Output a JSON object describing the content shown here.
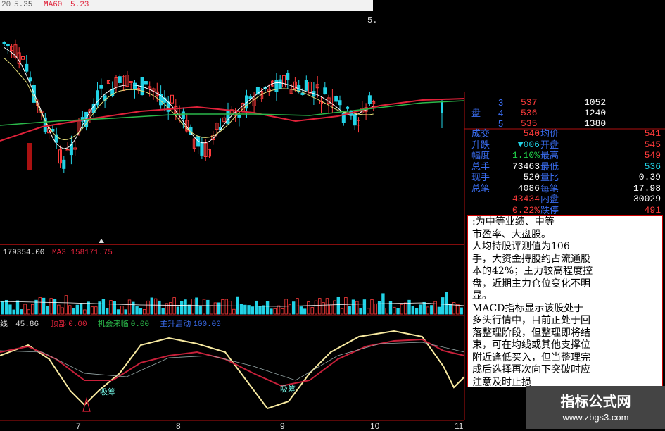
{
  "header": {
    "ma_prefix": "20",
    "ma_value": "5.35",
    "ma60_label": "MA60",
    "ma60_value": "5.23",
    "price_axis_top": "5."
  },
  "order_book": [
    {
      "side_label": "",
      "level": "3",
      "price": "537",
      "volume": "1052"
    },
    {
      "side_label": "盘",
      "level": "4",
      "price": "536",
      "volume": "1240"
    },
    {
      "side_label": "",
      "level": "5",
      "price": "535",
      "volume": "1380"
    }
  ],
  "quote": [
    {
      "label": "成交",
      "value": "540",
      "label2": "均价",
      "value2": "541",
      "color": "#ff3b3b",
      "color2": "#ff3b3b"
    },
    {
      "label": "升跌",
      "value": "▼006",
      "label2": "开盘",
      "value2": "545",
      "color": "#22d3e6",
      "color2": "#ff3b3b"
    },
    {
      "label": "幅度",
      "value": "1.10%",
      "label2": "最高",
      "value2": "549",
      "color": "#21d24a",
      "color2": "#ff3b3b"
    },
    {
      "label": "总手",
      "value": "73463",
      "label2": "最低",
      "value2": "536",
      "color": "#ffffff",
      "color2": "#22d3e6"
    },
    {
      "label": "现手",
      "value": "520",
      "label2": "量比",
      "value2": "0.39",
      "color": "#ffffff",
      "color2": "#ffffff"
    },
    {
      "label": "总笔",
      "value": "4086",
      "label2": "每笔",
      "value2": "17.98",
      "color": "#ffffff",
      "color2": "#ffffff"
    },
    {
      "label": "",
      "value": "43434",
      "label2": "内盘",
      "value2": "30029",
      "color": "#ff3b3b",
      "color2": "#ffffff"
    },
    {
      "label": "",
      "value": "0.22%",
      "label2": "跌停",
      "value2": "491",
      "color": "#ff3b3b",
      "color2": "#ff3b3b"
    }
  ],
  "commentary": [
    ":为中等业绩、中等",
    "市盈率、大盘股。",
    "    人均持股评测值为106",
    "手，大资金持股约占流通股",
    "本的42%；主力较高程度控",
    "盘，近期主力仓位变化不明",
    "显。",
    "    MACD指标显示该股处于",
    "多头行情中，目前正处于回",
    "落整理阶段，但整理即将结",
    "束，可在均线或其他支撑位",
    "附近逢低买入，但当整理完",
    "成后选择再次向下突破时应",
    "注意及时止损"
  ],
  "volume_panel": {
    "volume": "179354.00",
    "ma3_label": "MA3",
    "ma3_value": "158171.75"
  },
  "indicator_panel": {
    "line_label": "线",
    "line_value": "45.86",
    "item2_label": "顶部",
    "item2_value": "0.00",
    "item3_label": "机会来临",
    "item3_value": "0.00",
    "item4_label": "主升启动",
    "item4_value": "100.00",
    "marker_label": "吸筹"
  },
  "x_axis": {
    "ticks": [
      "7",
      "8",
      "9",
      "10",
      "11"
    ]
  },
  "watermark": {
    "title": "指标公式网",
    "url": "www.zbgs3.com"
  },
  "colors": {
    "up": "#ff3b3b",
    "down": "#22d3e6",
    "ma_red": "#e0223a",
    "ma_green": "#2bb84a",
    "osc_yellow": "#f7e9a0",
    "osc_red": "#c8203a"
  }
}
